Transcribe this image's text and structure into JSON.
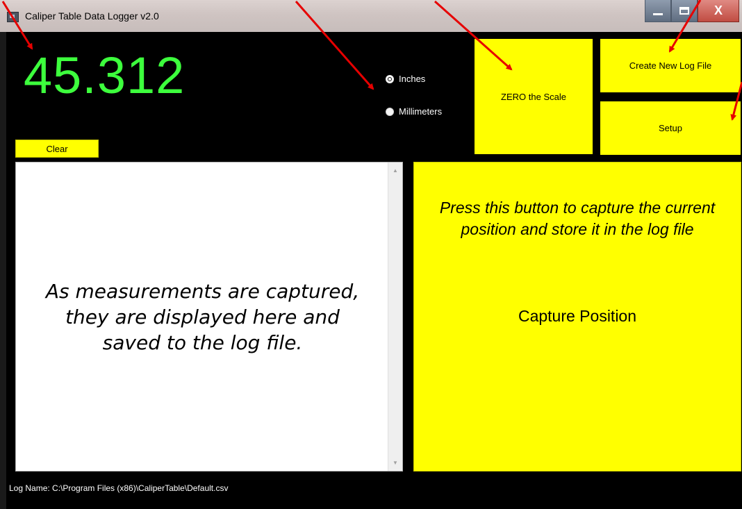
{
  "window": {
    "title": "Caliper Table Data Logger v2.0",
    "controls": {
      "minimize": "minimize-icon",
      "maximize": "maximize-icon",
      "close": "X"
    }
  },
  "reading": {
    "value": "45.312",
    "color": "#3dff3d"
  },
  "units": {
    "options": [
      {
        "label": "Inches",
        "checked": true
      },
      {
        "label": "Millimeters",
        "checked": false
      }
    ]
  },
  "buttons": {
    "zero": "ZERO the Scale",
    "create_log": "Create New Log File",
    "setup": "Setup",
    "clear": "Clear"
  },
  "log": {
    "placeholder": "As measurements are captured, they are displayed here and saved to the log file."
  },
  "capture": {
    "hint": "Press this button to capture the current position and store it in the log file",
    "label": "Capture Position"
  },
  "status": {
    "log_name": "Log Name: C:\\Program Files (x86)\\CaliperTable\\Default.csv"
  },
  "colors": {
    "accent": "#ffff00",
    "background": "#000000",
    "annotation": "#e60000"
  }
}
